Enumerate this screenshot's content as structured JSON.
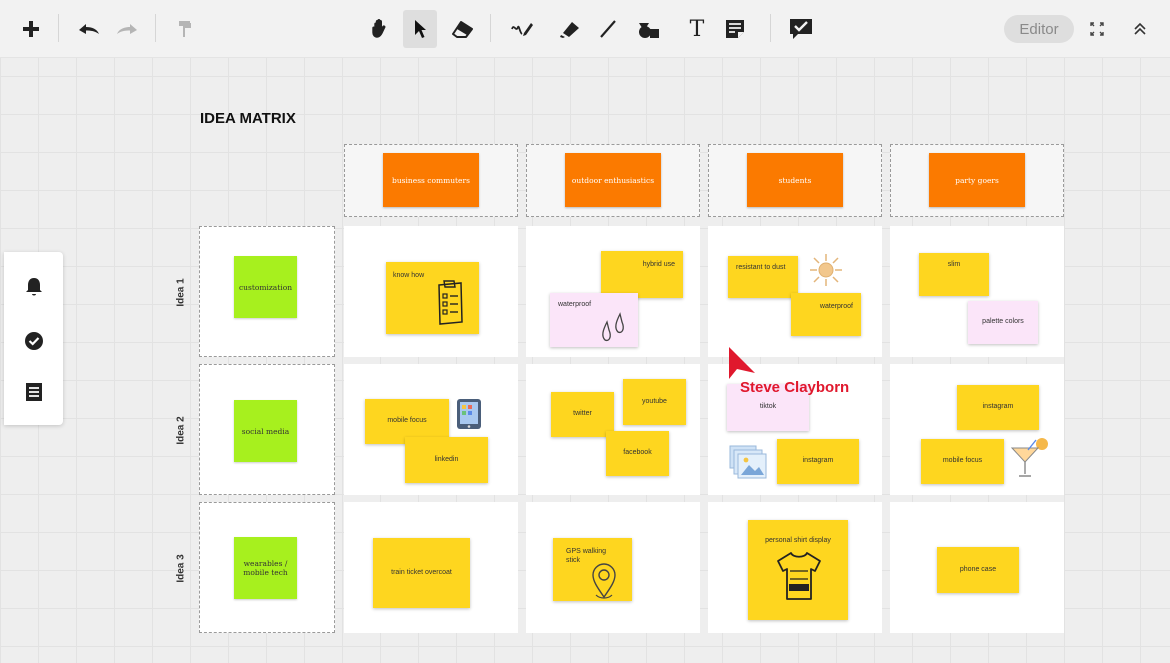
{
  "toolbar": {
    "editor_label": "Editor",
    "tools": [
      "add-icon",
      "undo-icon",
      "redo-icon",
      "format-painter-icon",
      "hand-icon",
      "select-icon",
      "eraser-icon",
      "pen-icon",
      "highlighter-icon",
      "line-icon",
      "shapes-icon",
      "text-icon",
      "sticky-note-icon",
      "vote-icon"
    ],
    "active_tool": "select-icon"
  },
  "sidebar": {
    "icons": [
      "bell-icon",
      "check-circle-icon",
      "list-icon"
    ]
  },
  "board": {
    "title": "IDEA MATRIX",
    "columns": [
      "business commuters",
      "outdoor enthusiastics",
      "students",
      "party goers"
    ],
    "rows": [
      {
        "label": "Idea 1",
        "theme": "customization"
      },
      {
        "label": "Idea 2",
        "theme": "social media"
      },
      {
        "label": "Idea 3",
        "theme": "wearables / mobile tech"
      }
    ],
    "notes": {
      "r1c1": "know how",
      "r1c2_a": "hybrid use",
      "r1c2_b": "waterproof",
      "r1c3_a": "resistant to dust",
      "r1c3_b": "waterproof",
      "r1c4_a": "slim",
      "r1c4_b": "palette colors",
      "r2c1_a": "mobile focus",
      "r2c1_b": "linkedin",
      "r2c2_a": "twitter",
      "r2c2_b": "youtube",
      "r2c2_c": "facebook",
      "r2c3_a": "tiktok",
      "r2c3_b": "instagram",
      "r2c4_a": "instagram",
      "r2c4_b": "mobile focus",
      "r3c1": "train ticket overcoat",
      "r3c2": "GPS walking stick",
      "r3c3": "personal shirt display",
      "r3c4": "phone case"
    }
  },
  "collaborator": {
    "name": "Steve Clayborn",
    "color": "#e0182d"
  },
  "colors": {
    "header_card": "#fb7a00",
    "theme_card": "#a7f01e",
    "sticky": "#fed61f",
    "sticky_pink": "#fbe5f9"
  }
}
